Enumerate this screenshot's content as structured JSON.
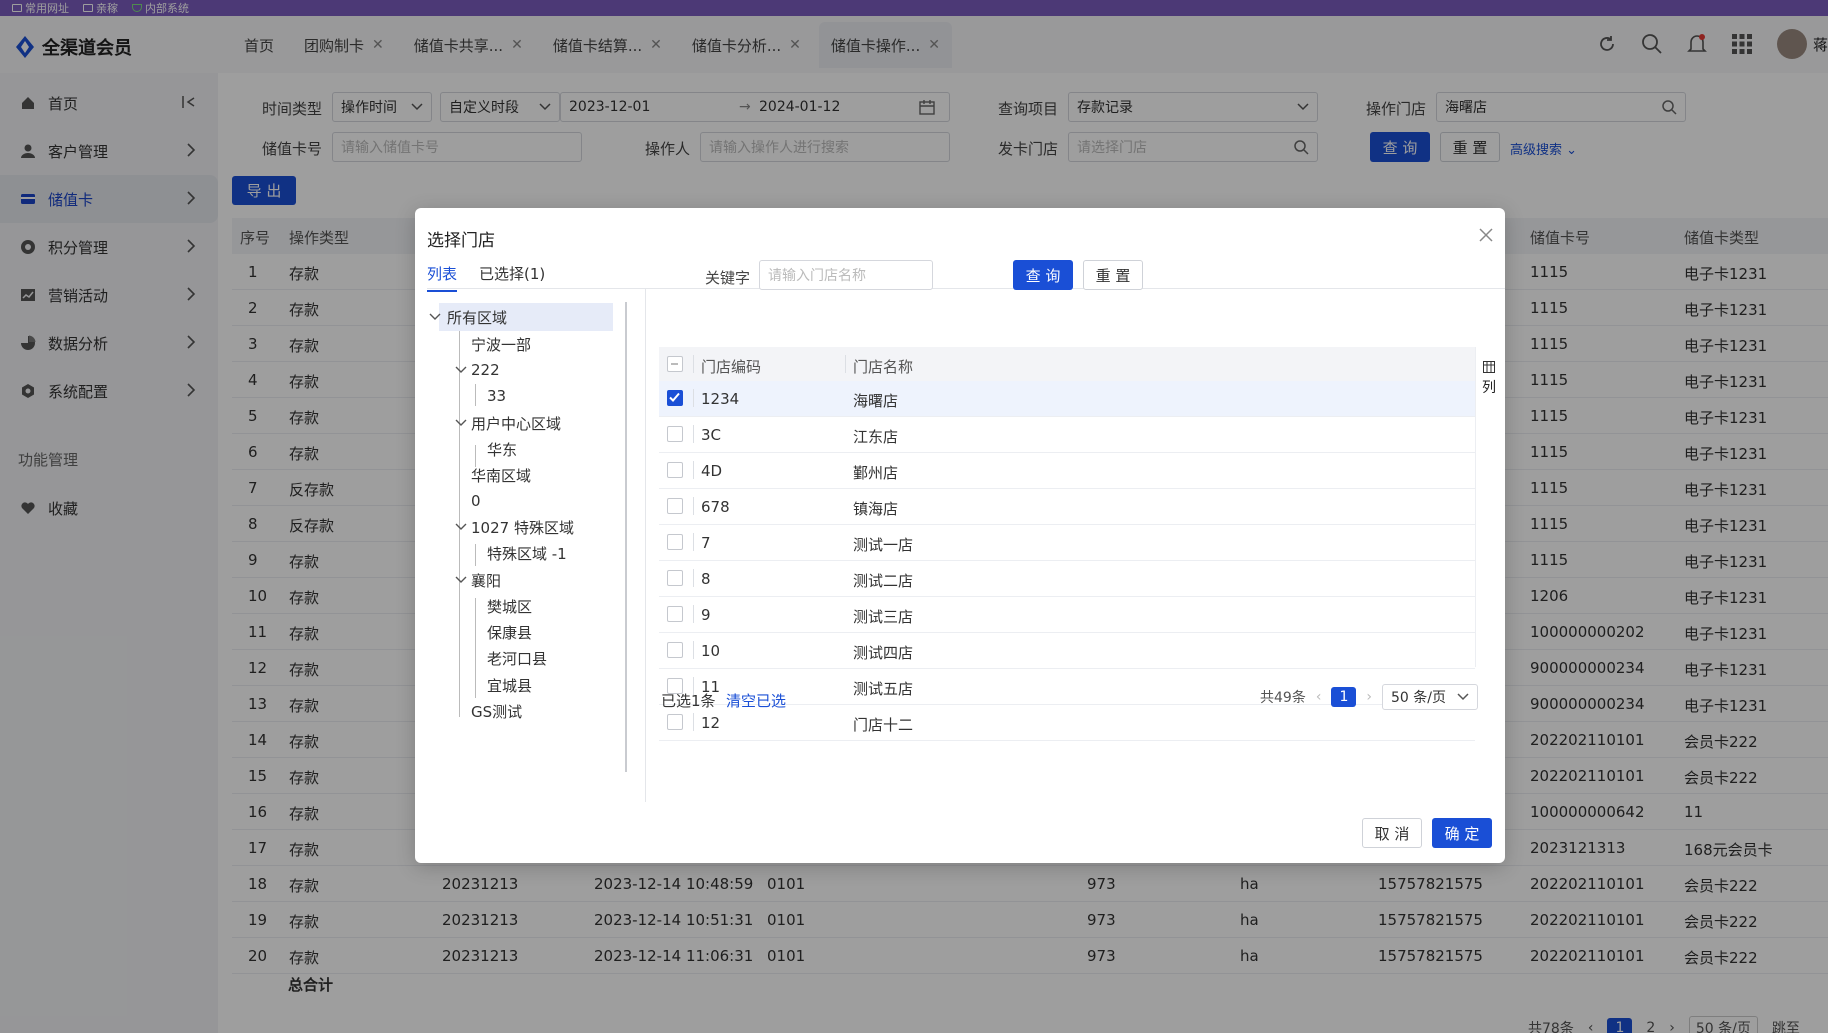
{
  "bookmarks": [
    "常用网址",
    "亲稼",
    "内部系统"
  ],
  "app": {
    "title": "全渠道会员"
  },
  "tabs": [
    {
      "label": "首页",
      "closable": false
    },
    {
      "label": "团购制卡",
      "closable": true
    },
    {
      "label": "储值卡共享...",
      "closable": true
    },
    {
      "label": "储值卡结算...",
      "closable": true
    },
    {
      "label": "储值卡分析...",
      "closable": true
    },
    {
      "label": "储值卡操作...",
      "closable": true,
      "active": true
    }
  ],
  "user": {
    "name_fragment": "蒋"
  },
  "sidebar": {
    "items": [
      {
        "label": "首页",
        "icon": "home-icon"
      },
      {
        "label": "客户管理",
        "icon": "user-icon"
      },
      {
        "label": "储值卡",
        "icon": "card-icon",
        "active": true
      },
      {
        "label": "积分管理",
        "icon": "points-icon"
      },
      {
        "label": "营销活动",
        "icon": "chart-icon"
      },
      {
        "label": "数据分析",
        "icon": "pie-icon"
      },
      {
        "label": "系统配置",
        "icon": "settings-icon"
      }
    ],
    "section_title": "功能管理",
    "favorites": "收藏"
  },
  "filters": {
    "time_type_label": "时间类型",
    "time_type_value": "操作时间",
    "period_value": "自定义时段",
    "date_start": "2023-12-01",
    "date_sep": "→",
    "date_end": "2024-01-12",
    "query_item_label": "查询项目",
    "query_item_value": "存款记录",
    "op_store_label": "操作门店",
    "op_store_value": "海曙店",
    "card_no_label": "储值卡号",
    "card_no_placeholder": "请输入储值卡号",
    "operator_label": "操作人",
    "operator_placeholder": "请输入操作人进行搜索",
    "issue_store_label": "发卡门店",
    "issue_store_placeholder": "请选择门店",
    "search_btn": "查 询",
    "reset_btn": "重 置",
    "advanced": "高级搜索"
  },
  "export_btn": "导 出",
  "table": {
    "headers": {
      "seq": "序号",
      "op_type": "操作类型",
      "card_no": "储值卡号",
      "card_type": "储值卡类型"
    },
    "rows": [
      {
        "seq": "1",
        "type": "存款",
        "card": "1115",
        "ctype": "电子卡1231"
      },
      {
        "seq": "2",
        "type": "存款",
        "card": "1115",
        "ctype": "电子卡1231"
      },
      {
        "seq": "3",
        "type": "存款",
        "card": "1115",
        "ctype": "电子卡1231"
      },
      {
        "seq": "4",
        "type": "存款",
        "card": "1115",
        "ctype": "电子卡1231"
      },
      {
        "seq": "5",
        "type": "存款",
        "card": "1115",
        "ctype": "电子卡1231"
      },
      {
        "seq": "6",
        "type": "存款",
        "card": "1115",
        "ctype": "电子卡1231"
      },
      {
        "seq": "7",
        "type": "反存款",
        "card": "1115",
        "ctype": "电子卡1231"
      },
      {
        "seq": "8",
        "type": "反存款",
        "card": "1115",
        "ctype": "电子卡1231"
      },
      {
        "seq": "9",
        "type": "存款",
        "card": "1115",
        "ctype": "电子卡1231"
      },
      {
        "seq": "10",
        "type": "存款",
        "card": "1206",
        "ctype": "电子卡1231"
      },
      {
        "seq": "11",
        "type": "存款",
        "card": "100000000202",
        "ctype": "电子卡1231"
      },
      {
        "seq": "12",
        "type": "存款",
        "card": "900000000234",
        "ctype": "电子卡1231"
      },
      {
        "seq": "13",
        "type": "存款",
        "card": "900000000234",
        "ctype": "电子卡1231"
      },
      {
        "seq": "14",
        "type": "存款",
        "card": "202202110101",
        "ctype": "会员卡222"
      },
      {
        "seq": "15",
        "type": "存款",
        "card": "202202110101",
        "ctype": "会员卡222"
      },
      {
        "seq": "16",
        "type": "存款",
        "card": "100000000642",
        "ctype": "11"
      },
      {
        "seq": "17",
        "type": "存款",
        "card": "2023121313",
        "ctype": "168元会员卡"
      },
      {
        "seq": "18",
        "type": "存款",
        "c3": "20231213",
        "c4": "2023-12-14 10:48:59",
        "c5": "0101",
        "c6": "973",
        "c7": "ha",
        "c8": "15757821575",
        "card": "202202110101",
        "ctype": "会员卡222"
      },
      {
        "seq": "19",
        "type": "存款",
        "c3": "20231213",
        "c4": "2023-12-14 10:51:31",
        "c5": "0101",
        "c6": "973",
        "c7": "ha",
        "c8": "15757821575",
        "card": "202202110101",
        "ctype": "会员卡222"
      },
      {
        "seq": "20",
        "type": "存款",
        "c3": "20231213",
        "c4": "2023-12-14 11:06:31",
        "c5": "0101",
        "c6": "973",
        "c7": "ha",
        "c8": "15757821575",
        "card": "202202110101",
        "ctype": "会员卡222"
      }
    ],
    "total_label": "总合计",
    "footer_total": "共78条",
    "footer_pages": [
      "1",
      "2"
    ],
    "footer_pagesize": "50 条/页",
    "footer_jump": "跳至"
  },
  "modal": {
    "title": "选择门店",
    "tabs": [
      "列表",
      "已选择(1)"
    ],
    "tree": [
      "所有区域",
      "宁波一部",
      "222",
      "33",
      "用户中心区域",
      "华东",
      "华南区域",
      "0",
      "1027 特殊区域",
      "特殊区域 -1",
      "襄阳",
      "樊城区",
      "保康县",
      "老河口县",
      "宜城县",
      "GS测试"
    ],
    "keyword_label": "关键字",
    "keyword_placeholder": "请输入门店名称",
    "search_btn": "查 询",
    "reset_btn": "重 置",
    "col_label": "列",
    "grid_headers": [
      "门店编码",
      "门店名称"
    ],
    "stores": [
      {
        "code": "1234",
        "name": "海曙店",
        "checked": true
      },
      {
        "code": "3C",
        "name": "江东店",
        "checked": false
      },
      {
        "code": "4D",
        "name": "鄞州店",
        "checked": false
      },
      {
        "code": "678",
        "name": "镇海店",
        "checked": false
      },
      {
        "code": "7",
        "name": "测试一店",
        "checked": false
      },
      {
        "code": "8",
        "name": "测试二店",
        "checked": false
      },
      {
        "code": "9",
        "name": "测试三店",
        "checked": false
      },
      {
        "code": "10",
        "name": "测试四店",
        "checked": false
      },
      {
        "code": "11",
        "name": "测试五店",
        "checked": false
      },
      {
        "code": "12",
        "name": "门店十二",
        "checked": false
      }
    ],
    "selected_count": "已选1条",
    "clear_selected": "清空已选",
    "total": "共49条",
    "page": "1",
    "page_size": "50 条/页",
    "cancel_btn": "取 消",
    "confirm_btn": "确 定"
  },
  "colors": {
    "primary": "#1a4fd6",
    "bookmark_bar": "#7b5cbf"
  }
}
